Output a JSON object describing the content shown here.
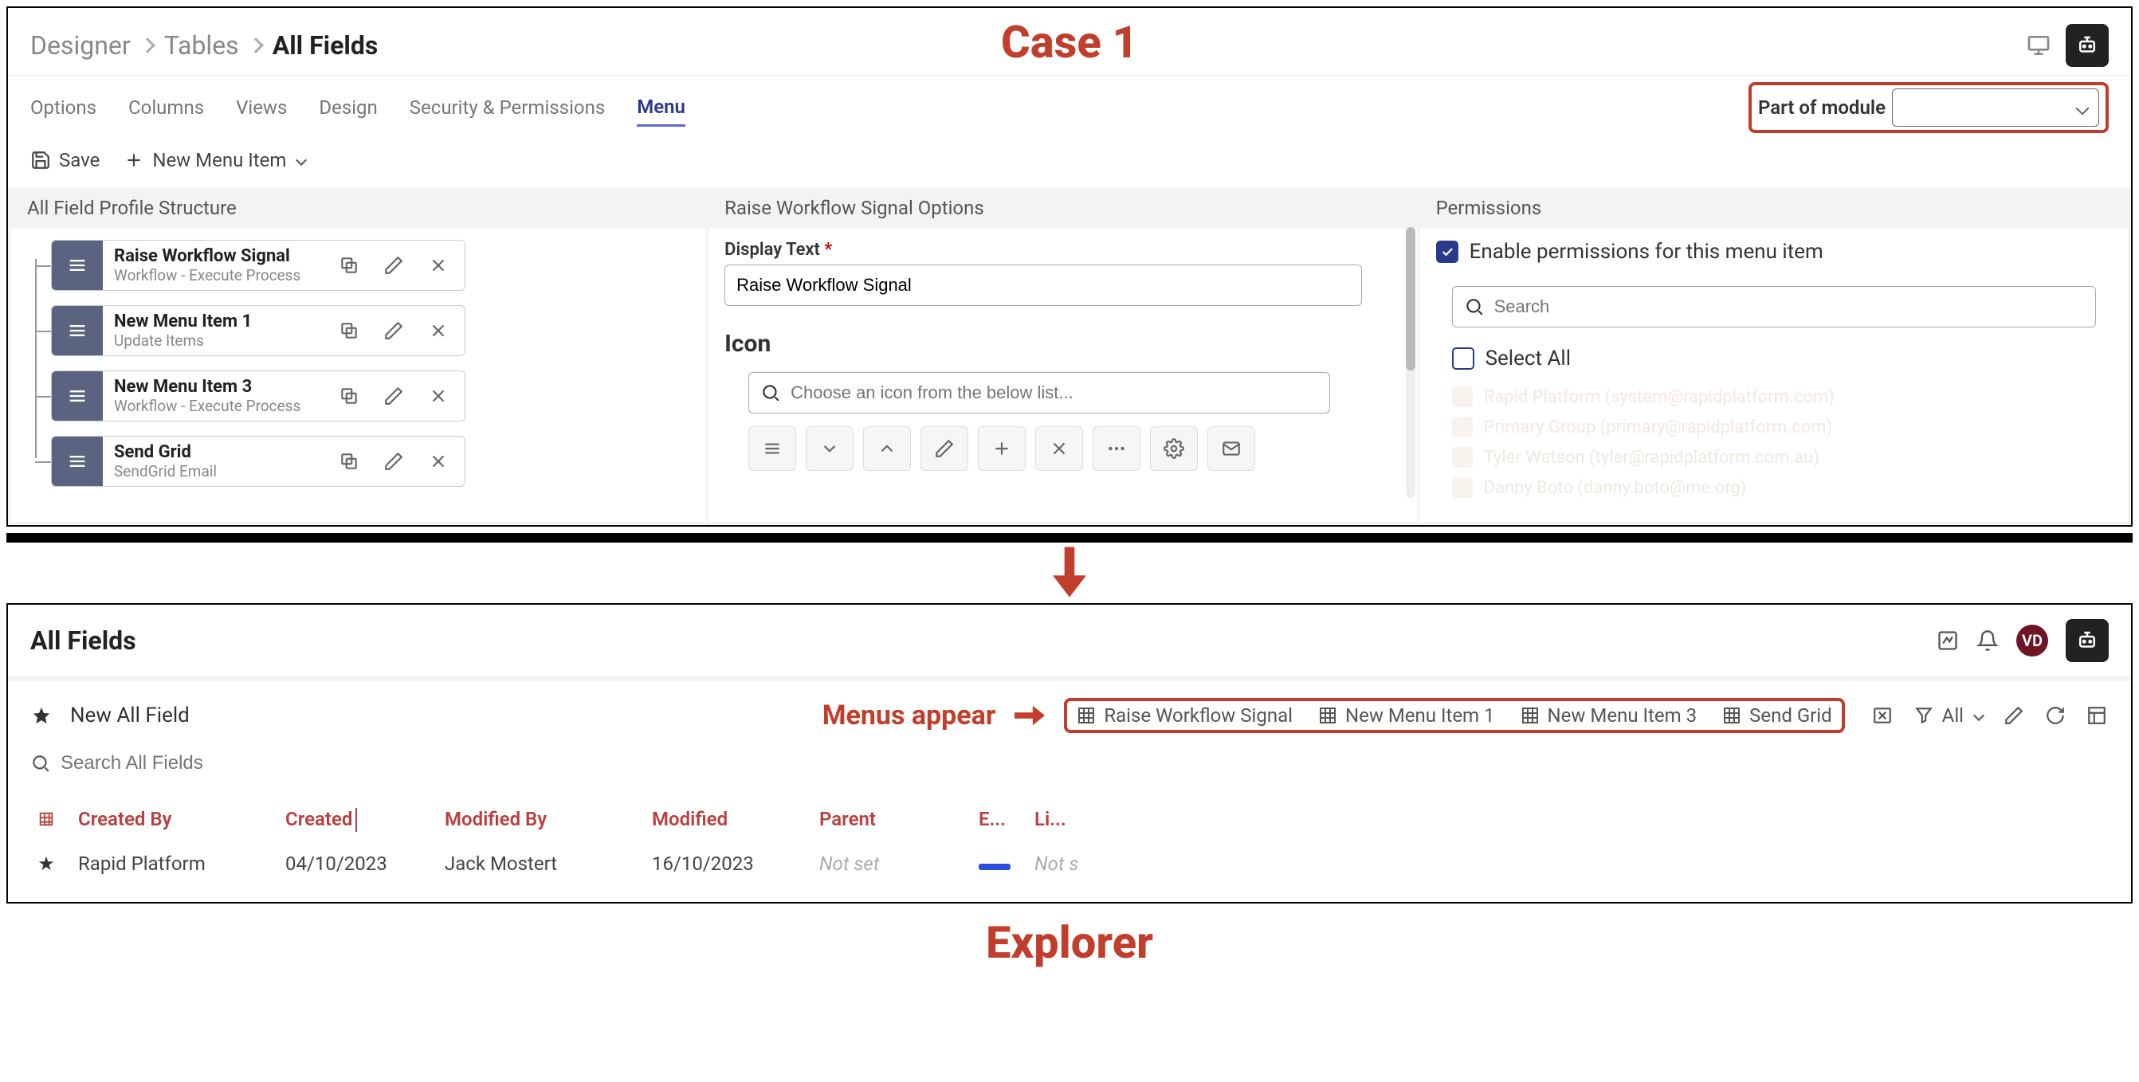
{
  "annotations": {
    "case": "Case 1",
    "menus_appear": "Menus appear",
    "explorer": "Explorer"
  },
  "top": {
    "breadcrumbs": [
      "Designer",
      "Tables",
      "All Fields"
    ],
    "tabs": [
      "Options",
      "Columns",
      "Views",
      "Design",
      "Security & Permissions",
      "Menu"
    ],
    "active_tab": "Menu",
    "part_of_module_label": "Part of module",
    "toolbar": {
      "save": "Save",
      "new_item": "New Menu Item"
    },
    "left_panel": {
      "title": "All Field Profile Structure",
      "items": [
        {
          "title": "Raise Workflow Signal",
          "sub": "Workflow - Execute Process"
        },
        {
          "title": "New Menu Item 1",
          "sub": "Update Items"
        },
        {
          "title": "New Menu Item 3",
          "sub": "Workflow - Execute Process"
        },
        {
          "title": "Send Grid",
          "sub": "SendGrid Email"
        }
      ]
    },
    "mid_panel": {
      "title": "Raise Workflow Signal Options",
      "display_text_label": "Display Text",
      "display_text_value": "Raise Workflow Signal",
      "icon_heading": "Icon",
      "icon_search_placeholder": "Choose an icon from the below list..."
    },
    "right_panel": {
      "title": "Permissions",
      "enable_label": "Enable permissions for this menu item",
      "search_placeholder": "Search",
      "select_all": "Select All",
      "faded_items": [
        "Rapid Platform (system@rapidplatform.com)",
        "Primary Group (primary@rapidplatform.com)",
        "Tyler Watson (tyler@rapidplatform.com.au)",
        "Danny Boto (danny.boto@me.org)"
      ]
    }
  },
  "bottom": {
    "title": "All Fields",
    "avatar": "VD",
    "new_label": "New All Field",
    "search_placeholder": "Search All Fields",
    "menus": [
      "Raise Workflow Signal",
      "New Menu Item 1",
      "New Menu Item 3",
      "Send Grid"
    ],
    "filter_all": "All",
    "columns": [
      "Created By",
      "Created",
      "Modified By",
      "Modified",
      "Parent",
      "E...",
      "Li..."
    ],
    "row": {
      "created_by": "Rapid Platform",
      "created": "04/10/2023",
      "modified_by": "Jack Mostert",
      "modified": "16/10/2023",
      "parent": "Not set",
      "li": "Not s"
    }
  }
}
